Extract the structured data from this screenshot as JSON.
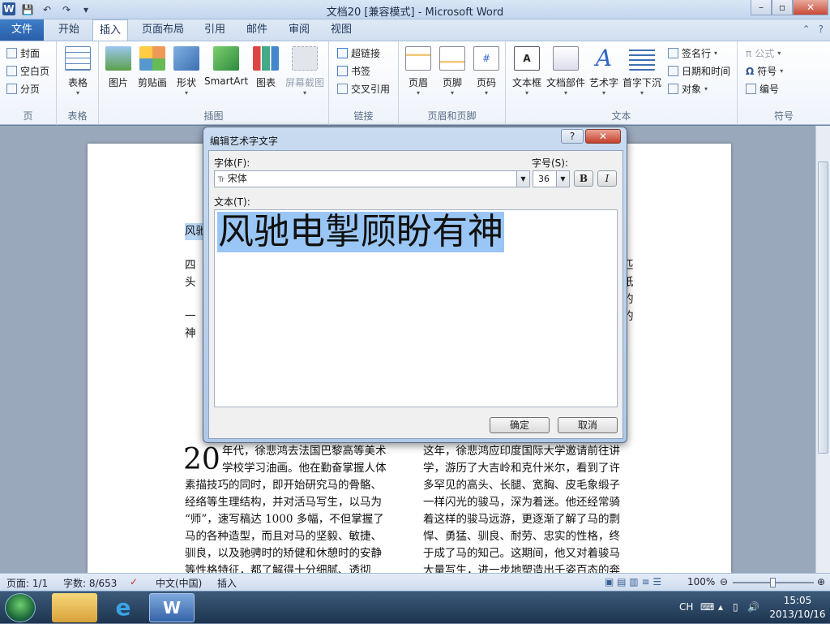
{
  "window": {
    "title": "文档20 [兼容模式] - Microsoft Word",
    "app_icon": "W",
    "controls": {
      "minimize": "–",
      "maximize": "▫",
      "close": "✕"
    }
  },
  "quick_access": {
    "save": "💾",
    "undo": "↶",
    "redo": "↷",
    "customize": "▾"
  },
  "ribbon_tabs": {
    "file": "文件",
    "tabs": [
      "开始",
      "插入",
      "页面布局",
      "引用",
      "邮件",
      "审阅",
      "视图"
    ],
    "active": "插入",
    "minimize_icon": "⌃",
    "help_icon": "?"
  },
  "ribbon": {
    "pages": {
      "cover": "封面",
      "blank": "空白页",
      "break": "分页",
      "label": "页"
    },
    "tables": {
      "table": "表格",
      "label": "表格"
    },
    "illustrations": {
      "picture": "图片",
      "clipart": "剪贴画",
      "shapes": "形状",
      "smartart": "SmartArt",
      "chart": "图表",
      "screenshot": "屏幕截图",
      "label": "插图"
    },
    "links": {
      "hyperlink": "超链接",
      "bookmark": "书签",
      "crossref": "交叉引用",
      "label": "链接"
    },
    "header_footer": {
      "header": "页眉",
      "footer": "页脚",
      "page_number": "页码",
      "label": "页眉和页脚"
    },
    "text": {
      "textbox": "文本框",
      "quickparts": "文档部件",
      "wordart": "艺术字",
      "dropcap": "首字下沉",
      "signature": "签名行",
      "datetime": "日期和时间",
      "object": "对象",
      "label": "文本"
    },
    "symbols": {
      "equation": "公式",
      "symbol": "符号",
      "number": "编号",
      "label": "符号"
    }
  },
  "document": {
    "line1_left": "风驰",
    "para1_left": [
      "四",
      "头"
    ],
    "para1_right": [
      "匹",
      "纸"
    ],
    "para2_left": [
      "一",
      "神"
    ],
    "para2_right": [
      "的",
      "的"
    ],
    "col1_dropcap": "20",
    "col1_lines": [
      "年代，徐悲鸿去法国巴黎高等美术",
      "学校学习油画。他在勤奋掌握人体",
      "素描技巧的同时，即开始研究马的骨骼、",
      "经络等生理结构，并对活马写生，以马为",
      "“师”，速写稿达 1000 多幅，不但掌握了",
      "马的各种造型，而且对马的坚毅、敏捷、",
      "驯良，以及驰骋时的矫健和休憩时的安静",
      "等性格特征，都了解得十分细腻、透彻"
    ],
    "col2_lines": [
      "这年，徐悲鸿应印度国际大学邀请前往讲",
      "学，游历了大吉岭和克什米尔，看到了许",
      "多罕见的高头、长腿、宽胸、皮毛象缎子",
      "一样闪光的骏马，深为着迷。他还经常骑",
      "着这样的骏马远游，更逐渐了解了马的剽",
      "悍、勇猛、驯良、耐劳、忠实的性格，终",
      "于成了马的知己。这期间，他又对着骏马",
      "大量写生，进一步地塑造出千姿百态的奔"
    ]
  },
  "dialog": {
    "title": "编辑艺术字文字",
    "help": "?",
    "close": "✕",
    "font_label": "字体(F):",
    "font_value": "宋体",
    "font_prefix": "Tr",
    "size_label": "字号(S):",
    "size_value": "36",
    "bold": "B",
    "italic": "I",
    "text_label": "文本(T):",
    "text_value": "风驰电掣顾盼有神",
    "ok": "确定",
    "cancel": "取消"
  },
  "statusbar": {
    "page": "页面: 1/1",
    "words": "字数: 8/653",
    "language": "中文(中国)",
    "mode": "插入",
    "zoom": "100%",
    "zoom_level": 0.5
  },
  "taskbar": {
    "lang": "CH",
    "time": "15:05",
    "date": "2013/10/16"
  }
}
